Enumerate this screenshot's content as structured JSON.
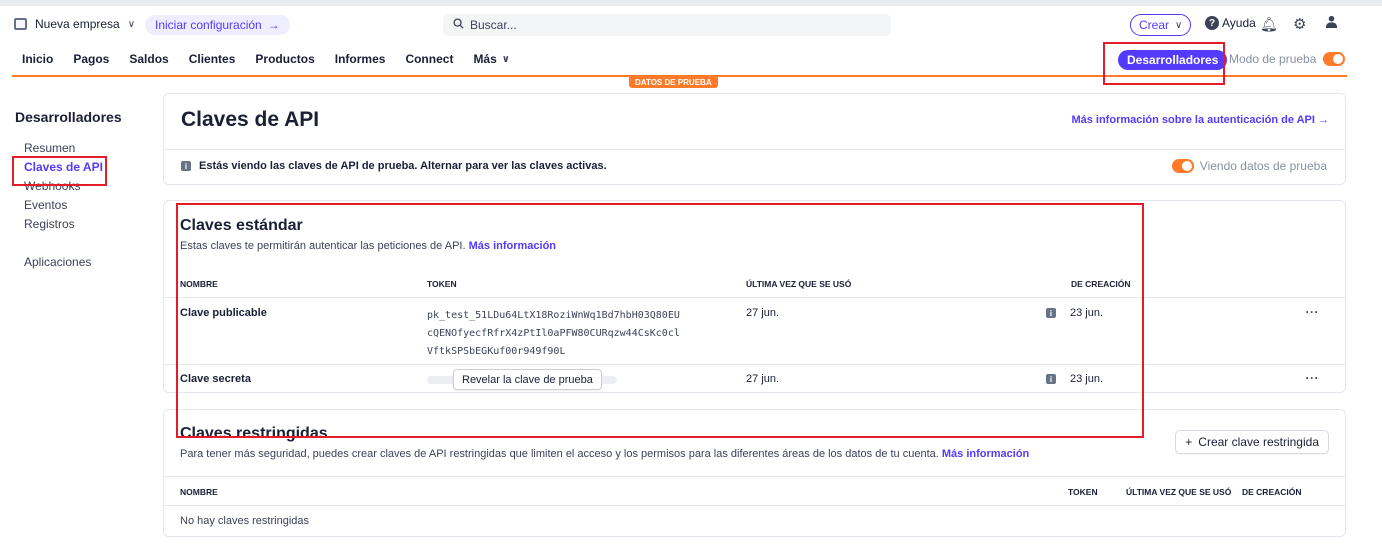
{
  "topbar": {
    "company": "Nueva empresa",
    "setup": "Iniciar configuración",
    "setup_arrow": "→",
    "search_placeholder": "Buscar...",
    "create": "Crear",
    "help": "Ayuda"
  },
  "nav": {
    "items": [
      "Inicio",
      "Pagos",
      "Saldos",
      "Clientes",
      "Productos",
      "Informes",
      "Connect",
      "Más"
    ],
    "developers": "Desarrolladores",
    "test_mode": "Modo de prueba",
    "test_badge": "DATOS DE PRUEBA"
  },
  "sidebar": {
    "title": "Desarrolladores",
    "items": [
      "Resumen",
      "Claves de API",
      "Webhooks",
      "Eventos",
      "Registros",
      "Aplicaciones"
    ]
  },
  "api_keys": {
    "title": "Claves de API",
    "auth_link": "Más información sobre la autenticación de API →",
    "info_text": "Estás viendo las claves de API de prueba. Alternar para ver las claves activas.",
    "viewing_test": "Viendo datos de prueba"
  },
  "standard": {
    "title": "Claves estándar",
    "subtitle": "Estas claves te permitirán autenticar las peticiones de API.",
    "more_info": "Más información",
    "headers": [
      "NOMBRE",
      "TOKEN",
      "ÚLTIMA VEZ QUE SE USÓ",
      "DE CREACIÓN"
    ],
    "rows": [
      {
        "name": "Clave publicable",
        "token_lines": [
          "pk_test_51LDu64LtX18RoziWnWq1Bd7hbH03Q80EU",
          "cQENOfyecfRfrX4zPtIl0aPFW80CURqzw44CsKc0cl",
          "VftkSPSbEGKuf00r949f90L"
        ],
        "last_used": "27 jun.",
        "created": "23 jun."
      },
      {
        "name": "Clave secreta",
        "reveal": "Revelar la clave de prueba",
        "last_used": "27 jun.",
        "created": "23 jun."
      }
    ]
  },
  "restricted": {
    "title": "Claves restringidas",
    "subtitle": "Para tener más seguridad, puedes crear claves de API restringidas que limiten el acceso y los permisos para las diferentes áreas de los datos de tu cuenta.",
    "more_info": "Más información",
    "create_button": "Crear clave restringida",
    "headers": [
      "NOMBRE",
      "TOKEN",
      "ÚLTIMA VEZ QUE SE USÓ",
      "DE CREACIÓN"
    ],
    "empty": "No hay claves restringidas"
  },
  "colors": {
    "accent": "#533afd",
    "test_orange": "#ff7a29",
    "highlight": "#e11d2a"
  }
}
